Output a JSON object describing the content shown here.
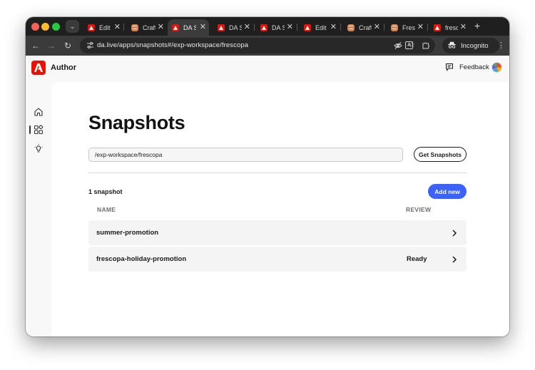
{
  "browser": {
    "tabs": [
      {
        "label": "Edit",
        "favicon": "adobe"
      },
      {
        "label": "Craft",
        "favicon": "craft"
      },
      {
        "label": "DA Snapshots",
        "favicon": "adobe",
        "active": true
      },
      {
        "label": "DA S",
        "favicon": "adobe"
      },
      {
        "label": "DA S",
        "favicon": "adobe"
      },
      {
        "label": "Edit",
        "favicon": "adobe"
      },
      {
        "label": "Craft",
        "favicon": "craft"
      },
      {
        "label": "Fresc",
        "favicon": "craft"
      },
      {
        "label": "fresc",
        "favicon": "adobe"
      }
    ],
    "tab_close": "✕",
    "new_tab": "+",
    "url": "da.live/apps/snapshots#/exp-workspace/frescopa",
    "incognito_label": "Incognito",
    "ext_letter": "A"
  },
  "app": {
    "brand": "Author",
    "feedback_label": "Feedback",
    "accent_color": "#3b63fb",
    "brand_color": "#eb1000"
  },
  "page": {
    "title": "Snapshots",
    "path_value": "/exp-workspace/frescopa",
    "get_button": "Get Snapshots",
    "count_label": "1 snapshot",
    "add_button": "Add new",
    "columns": {
      "name": "NAME",
      "review": "REVIEW"
    },
    "rows": [
      {
        "name": "summer-promotion",
        "review": ""
      },
      {
        "name": "frescopa-holiday-promotion",
        "review": "Ready"
      }
    ]
  }
}
